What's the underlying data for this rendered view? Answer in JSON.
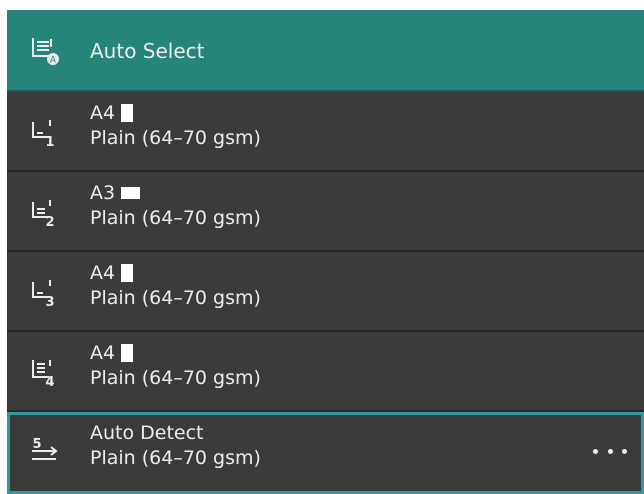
{
  "colors": {
    "panel_bg": "#333333",
    "row_bg": "#3b3b3b",
    "selected_bg": "#25857a",
    "focus_border": "#2f9aa0",
    "text": "#ececec"
  },
  "trays": [
    {
      "icon": "auto-select-tray-icon",
      "label": "Auto Select",
      "state": "selected"
    },
    {
      "icon": "tray-1-icon",
      "tray_number": "1",
      "size": "A4",
      "orientation": "portrait",
      "paper_type": "Plain (64–70 gsm)"
    },
    {
      "icon": "tray-2-icon",
      "tray_number": "2",
      "size": "A3",
      "orientation": "landscape",
      "paper_type": "Plain (64–70 gsm)"
    },
    {
      "icon": "tray-3-icon",
      "tray_number": "3",
      "size": "A4",
      "orientation": "portrait",
      "paper_type": "Plain (64–70 gsm)"
    },
    {
      "icon": "tray-4-icon",
      "tray_number": "4",
      "size": "A4",
      "orientation": "portrait",
      "paper_type": "Plain (64–70 gsm)"
    },
    {
      "icon": "bypass-tray-5-icon",
      "tray_number": "5",
      "size": "Auto Detect",
      "paper_type": "Plain (64–70 gsm)",
      "state": "focused",
      "more_icon": "more-options-icon"
    }
  ]
}
